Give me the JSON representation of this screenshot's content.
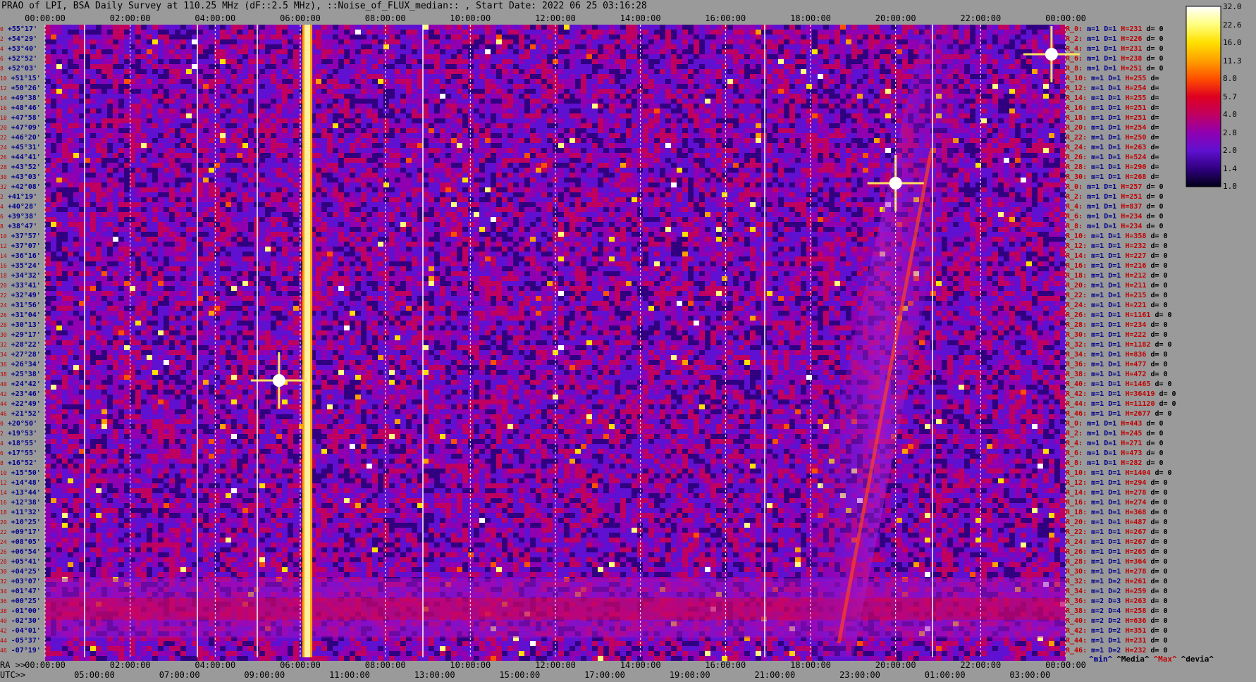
{
  "title": "PRAO of LPI, BSA Daily Survey at 110.25 MHz (dF::2.5 MHz), ::Noise_of_FLUX_median:: , Start Date: 2022 06 25 03:16:28",
  "chart_data": {
    "type": "heatmap",
    "title": "PRAO of LPI, BSA Daily Survey at 110.25 MHz (dF::2.5 MHz), ::Noise_of_FLUX_median:: , Start Date: 2022 06 25 03:16:28",
    "top_axis_ticks": [
      "00:00:00",
      "02:00:00",
      "04:00:00",
      "06:00:00",
      "08:00:00",
      "10:00:00",
      "12:00:00",
      "14:00:00",
      "16:00:00",
      "18:00:00",
      "20:00:00",
      "22:00:00",
      "00:00:00"
    ],
    "ra_axis_label": "RA >>",
    "ra_axis_ticks": [
      "00:00:00",
      "02:00:00",
      "04:00:00",
      "06:00:00",
      "08:00:00",
      "10:00:00",
      "12:00:00",
      "14:00:00",
      "16:00:00",
      "18:00:00",
      "20:00:00",
      "22:00:00",
      "00:00:00"
    ],
    "utc_axis_label": "UTC>>",
    "utc_axis_ticks": [
      "05:00:00",
      "07:00:00",
      "09:00:00",
      "11:00:00",
      "13:00:00",
      "15:00:00",
      "17:00:00",
      "19:00:00",
      "21:00:00",
      "23:00:00",
      "01:00:00",
      "03:00:00"
    ],
    "colorbar_ticks": [
      "32.0",
      "22.6",
      "16.0",
      "11.3",
      "8.0",
      "5.7",
      "4.0",
      "2.8",
      "2.0",
      "1.4",
      "1.0"
    ],
    "colorbar_colors": [
      "#ffffff",
      "#ffff80",
      "#ffe000",
      "#ffa000",
      "#ff5000",
      "#e00020",
      "#c00060",
      "#9000b0",
      "#6010d0",
      "#300080",
      "#000018"
    ],
    "declination_labels": [
      [
        "0",
        "+55°17'"
      ],
      [
        "2",
        "+54°29'"
      ],
      [
        "4",
        "+53°40'"
      ],
      [
        "6",
        "+52°52'"
      ],
      [
        "8",
        "+52°03'"
      ],
      [
        "10",
        "+51°15'"
      ],
      [
        "12",
        "+50°26'"
      ],
      [
        "14",
        "+49°38'"
      ],
      [
        "16",
        "+48°46'"
      ],
      [
        "18",
        "+47°58'"
      ],
      [
        "20",
        "+47°09'"
      ],
      [
        "22",
        "+46°20'"
      ],
      [
        "24",
        "+45°31'"
      ],
      [
        "26",
        "+44°41'"
      ],
      [
        "28",
        "+43°52'"
      ],
      [
        "30",
        "+43°03'"
      ],
      [
        "32",
        "+42°08'"
      ],
      [
        "2",
        "+41°19'"
      ],
      [
        "4",
        "+40°28'"
      ],
      [
        "6",
        "+39°38'"
      ],
      [
        "8",
        "+38°47'"
      ],
      [
        "10",
        "+37°57'"
      ],
      [
        "12",
        "+37°07'"
      ],
      [
        "14",
        "+36°16'"
      ],
      [
        "16",
        "+35°24'"
      ],
      [
        "18",
        "+34°32'"
      ],
      [
        "20",
        "+33°41'"
      ],
      [
        "22",
        "+32°49'"
      ],
      [
        "24",
        "+31°56'"
      ],
      [
        "26",
        "+31°04'"
      ],
      [
        "28",
        "+30°13'"
      ],
      [
        "30",
        "+29°17'"
      ],
      [
        "32",
        "+28°22'"
      ],
      [
        "34",
        "+27°28'"
      ],
      [
        "36",
        "+26°34'"
      ],
      [
        "38",
        "+25°38'"
      ],
      [
        "40",
        "+24°42'"
      ],
      [
        "42",
        "+23°46'"
      ],
      [
        "44",
        "+22°49'"
      ],
      [
        "46",
        "+21°52'"
      ],
      [
        "0",
        "+20°50'"
      ],
      [
        "2",
        "+19°53'"
      ],
      [
        "4",
        "+18°55'"
      ],
      [
        "6",
        "+17°55'"
      ],
      [
        "8",
        "+16°52'"
      ],
      [
        "10",
        "+15°50'"
      ],
      [
        "12",
        "+14°48'"
      ],
      [
        "14",
        "+13°44'"
      ],
      [
        "16",
        "+12°38'"
      ],
      [
        "18",
        "+11°32'"
      ],
      [
        "20",
        "+10°25'"
      ],
      [
        "22",
        "+09°17'"
      ],
      [
        "24",
        "+08°05'"
      ],
      [
        "26",
        "+06°54'"
      ],
      [
        "28",
        "+05°41'"
      ],
      [
        "30",
        "+04°25'"
      ],
      [
        "32",
        "+03°07'"
      ],
      [
        "34",
        "+01°47'"
      ],
      [
        "36",
        "+00°25'"
      ],
      [
        "38",
        "-01°00'"
      ],
      [
        "40",
        "-02°30'"
      ],
      [
        "42",
        "-04°01'"
      ],
      [
        "44",
        "-05°37'"
      ],
      [
        "46",
        "-07°19'"
      ]
    ],
    "channel_stats": [
      [
        "R_0:",
        "1",
        "1",
        "231",
        "d= 0"
      ],
      [
        "R_2:",
        "1",
        "1",
        "226",
        "d= 0"
      ],
      [
        "R_4:",
        "1",
        "1",
        "231",
        "d= 0"
      ],
      [
        "R_6:",
        "1",
        "1",
        "238",
        "d= 0"
      ],
      [
        "R_8:",
        "1",
        "1",
        "251",
        "d= 0"
      ],
      [
        "R_10:",
        "1",
        "1",
        "255",
        "d="
      ],
      [
        "R_12:",
        "1",
        "1",
        "254",
        "d="
      ],
      [
        "R_14:",
        "1",
        "1",
        "255",
        "d="
      ],
      [
        "R_16:",
        "1",
        "1",
        "251",
        "d="
      ],
      [
        "R_18:",
        "1",
        "1",
        "251",
        "d="
      ],
      [
        "R_20:",
        "1",
        "1",
        "254",
        "d="
      ],
      [
        "R_22:",
        "1",
        "1",
        "250",
        "d="
      ],
      [
        "R_24:",
        "1",
        "1",
        "263",
        "d="
      ],
      [
        "R_26:",
        "1",
        "1",
        "524",
        "d="
      ],
      [
        "R_28:",
        "1",
        "1",
        "290",
        "d="
      ],
      [
        "R_30:",
        "1",
        "1",
        "268",
        "d="
      ],
      [
        "R_0:",
        "1",
        "1",
        "257",
        "d= 0"
      ],
      [
        "R_2:",
        "1",
        "1",
        "251",
        "d= 0"
      ],
      [
        "R_4:",
        "1",
        "1",
        "837",
        "d= 0"
      ],
      [
        "R_6:",
        "1",
        "1",
        "234",
        "d= 0"
      ],
      [
        "R_8:",
        "1",
        "1",
        "234",
        "d= 0"
      ],
      [
        "R_10:",
        "1",
        "1",
        "358",
        "d= 0"
      ],
      [
        "R_12:",
        "1",
        "1",
        "232",
        "d= 0"
      ],
      [
        "R_14:",
        "1",
        "1",
        "227",
        "d= 0"
      ],
      [
        "R_16:",
        "1",
        "1",
        "216",
        "d= 0"
      ],
      [
        "R_18:",
        "1",
        "1",
        "212",
        "d= 0"
      ],
      [
        "R_20:",
        "1",
        "1",
        "211",
        "d= 0"
      ],
      [
        "R_22:",
        "1",
        "1",
        "215",
        "d= 0"
      ],
      [
        "R_24:",
        "1",
        "1",
        "221",
        "d= 0"
      ],
      [
        "R_26:",
        "1",
        "1",
        "1161",
        "d= 0"
      ],
      [
        "R_28:",
        "1",
        "1",
        "234",
        "d= 0"
      ],
      [
        "R_30:",
        "1",
        "1",
        "222",
        "d= 0"
      ],
      [
        "R_32:",
        "1",
        "1",
        "1182",
        "d= 0"
      ],
      [
        "R_34:",
        "1",
        "1",
        "836",
        "d= 0"
      ],
      [
        "R_36:",
        "1",
        "1",
        "477",
        "d= 0"
      ],
      [
        "R_38:",
        "1",
        "1",
        "472",
        "d= 0"
      ],
      [
        "R_40:",
        "1",
        "1",
        "1465",
        "d= 0"
      ],
      [
        "R_42:",
        "1",
        "1",
        "36419",
        "d= 0"
      ],
      [
        "R_44:",
        "1",
        "1",
        "11120",
        "d= 0"
      ],
      [
        "R_46:",
        "1",
        "1",
        "2677",
        "d= 0"
      ],
      [
        "R_0:",
        "1",
        "1",
        "443",
        "d= 0"
      ],
      [
        "R_2:",
        "1",
        "1",
        "245",
        "d= 0"
      ],
      [
        "R_4:",
        "1",
        "1",
        "271",
        "d= 0"
      ],
      [
        "R_6:",
        "1",
        "1",
        "473",
        "d= 0"
      ],
      [
        "R_8:",
        "1",
        "1",
        "282",
        "d= 0"
      ],
      [
        "R_10:",
        "1",
        "1",
        "1404",
        "d= 0"
      ],
      [
        "R_12:",
        "1",
        "1",
        "294",
        "d= 0"
      ],
      [
        "R_14:",
        "1",
        "1",
        "278",
        "d= 0"
      ],
      [
        "R_16:",
        "1",
        "1",
        "274",
        "d= 0"
      ],
      [
        "R_18:",
        "1",
        "1",
        "368",
        "d= 0"
      ],
      [
        "R_20:",
        "1",
        "1",
        "487",
        "d= 0"
      ],
      [
        "R_22:",
        "1",
        "1",
        "267",
        "d= 0"
      ],
      [
        "R_24:",
        "1",
        "1",
        "267",
        "d= 0"
      ],
      [
        "R_26:",
        "1",
        "1",
        "265",
        "d= 0"
      ],
      [
        "R_28:",
        "1",
        "1",
        "364",
        "d= 0"
      ],
      [
        "R_30:",
        "1",
        "1",
        "278",
        "d= 0"
      ],
      [
        "R_32:",
        "1",
        "2",
        "261",
        "d= 0"
      ],
      [
        "R_34:",
        "1",
        "2",
        "259",
        "d= 0"
      ],
      [
        "R_36:",
        "2",
        "3",
        "263",
        "d= 0"
      ],
      [
        "R_38:",
        "2",
        "4",
        "258",
        "d= 0"
      ],
      [
        "R_40:",
        "2",
        "2",
        "636",
        "d= 0"
      ],
      [
        "R_42:",
        "1",
        "2",
        "351",
        "d= 0"
      ],
      [
        "R_44:",
        "1",
        "1",
        "231",
        "d= 0"
      ],
      [
        "R_46:",
        "1",
        "2",
        "232",
        "d= 0"
      ]
    ],
    "stats_legend": [
      "^min^",
      "^Media^",
      "^Max^",
      "^devia^"
    ],
    "features": {
      "bright_vertical_source_ra": "06:10:00",
      "bright_point_sources_ra": [
        "05:30:00",
        "20:00:00",
        "23:40:00"
      ],
      "horizontal_band_dec_range": [
        "+03°07'",
        "-04°01'"
      ],
      "drift_band_ra": [
        "18:00:00",
        "21:00:00"
      ]
    }
  }
}
